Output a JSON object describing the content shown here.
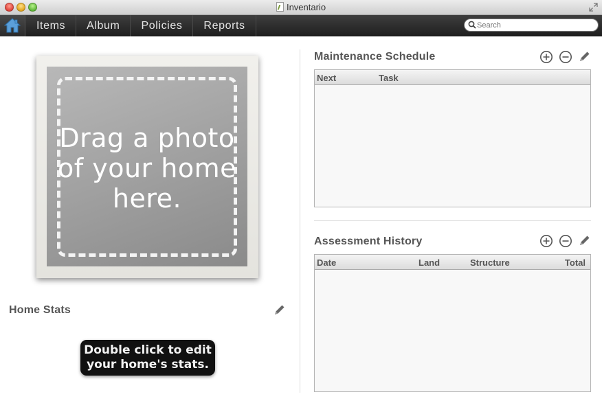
{
  "window": {
    "title": "Inventario"
  },
  "search": {
    "placeholder": "Search"
  },
  "nav": {
    "items": [
      {
        "label": "Items"
      },
      {
        "label": "Album"
      },
      {
        "label": "Policies"
      },
      {
        "label": "Reports"
      }
    ]
  },
  "photo": {
    "line1": "Drag a photo",
    "line2": "of your home",
    "line3": "here."
  },
  "home_stats": {
    "title": "Home Stats",
    "hint_line1": "Double click to edit",
    "hint_line2": "your home's stats."
  },
  "maintenance": {
    "title": "Maintenance Schedule",
    "columns": [
      "Next",
      "Task"
    ]
  },
  "assessment": {
    "title": "Assessment History",
    "columns": [
      "Date",
      "Land",
      "Structure",
      "Total"
    ]
  },
  "icons": {
    "home": "home-icon",
    "search": "search-icon",
    "add": "plus-circle-icon",
    "remove": "minus-circle-icon",
    "edit": "pencil-icon"
  },
  "colors": {
    "toolbar": "#2e2e2e",
    "home_accent": "#5b9fd9"
  }
}
